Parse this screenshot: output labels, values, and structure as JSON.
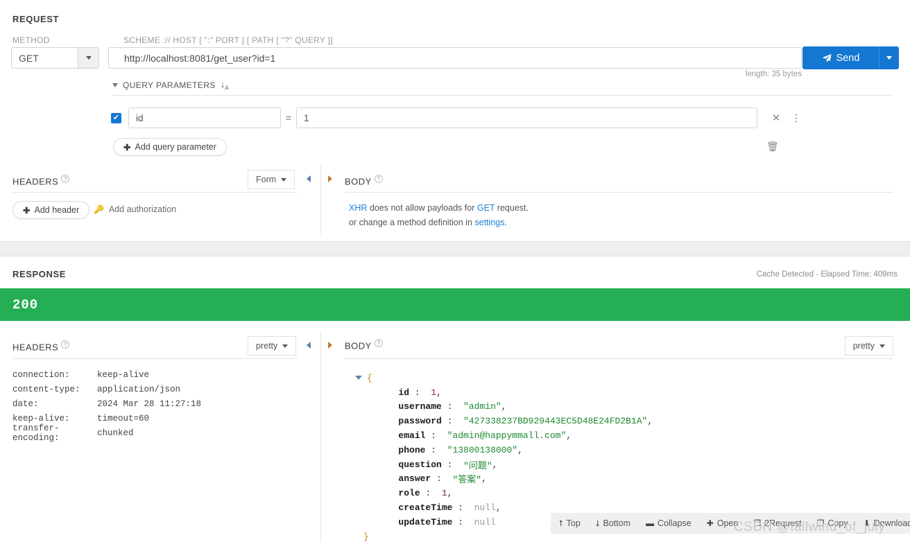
{
  "request": {
    "title": "REQUEST",
    "method_label": "METHOD",
    "method_value": "GET",
    "url_label": "SCHEME :// HOST [ \":\" PORT ] [ PATH [ \"?\" QUERY ]]",
    "url_value": "http://localhost:8081/get_user?id=1",
    "length_note": "length: 35 bytes",
    "send_label": "Send",
    "query_parameters": {
      "title": "QUERY PARAMETERS",
      "sort_icon": "sort-icon",
      "rows": [
        {
          "enabled": true,
          "key": "id",
          "equals": "=",
          "value": "1"
        }
      ],
      "add_label": "Add query parameter",
      "remove_icon": "close-icon",
      "menu_icon": "more-vertical-icon",
      "trash_icon": "trash-icon"
    },
    "headers": {
      "title": "HEADERS",
      "format_value": "Form",
      "add_header_label": "Add header",
      "add_authorization_label": "Add authorization"
    },
    "body": {
      "title": "BODY",
      "message_line1_pre": "",
      "message_line1_link1": "XHR",
      "message_line1_mid": " does not allow payloads for ",
      "message_line1_link2": "GET",
      "message_line1_post": " request.",
      "message_line2_pre": "or change a method definition in ",
      "message_line2_link": "settings",
      "message_line2_post": "."
    }
  },
  "response": {
    "title": "RESPONSE",
    "elapsed": "Cache Detected - Elapsed Time: 409ms",
    "status_code": "200",
    "status_color": "#24af55",
    "headers": {
      "title": "HEADERS",
      "format_value": "pretty",
      "rows": [
        {
          "name": "connection:",
          "value": "keep-alive"
        },
        {
          "name": "content-type:",
          "value": "application/json"
        },
        {
          "name": "date:",
          "value": "2024 Mar 28 11:27:18"
        },
        {
          "name": "keep-alive:",
          "value": "timeout=60"
        },
        {
          "name": "transfer-encoding:",
          "value": "chunked"
        }
      ]
    },
    "body": {
      "title": "BODY",
      "format_value": "pretty",
      "json_lines": [
        {
          "indent": 0,
          "toggle": true,
          "brace": "{"
        },
        {
          "indent": 1,
          "key": "id",
          "sep": " : ",
          "value": "1",
          "kind": "num",
          "comma": ","
        },
        {
          "indent": 1,
          "key": "username",
          "sep": " : ",
          "value": "\"admin\"",
          "kind": "str",
          "comma": ","
        },
        {
          "indent": 1,
          "key": "password",
          "sep": " : ",
          "value": "\"427338237BD929443EC5D48E24FD2B1A\"",
          "kind": "str",
          "comma": ","
        },
        {
          "indent": 1,
          "key": "email",
          "sep": " : ",
          "value": "\"admin@happymmall.com\"",
          "kind": "str",
          "comma": ","
        },
        {
          "indent": 1,
          "key": "phone",
          "sep": " : ",
          "value": "\"13800138000\"",
          "kind": "str",
          "comma": ","
        },
        {
          "indent": 1,
          "key": "question",
          "sep": " : ",
          "value": "\"问题\"",
          "kind": "str",
          "comma": ","
        },
        {
          "indent": 1,
          "key": "answer",
          "sep": " : ",
          "value": "\"答案\"",
          "kind": "str",
          "comma": ","
        },
        {
          "indent": 1,
          "key": "role",
          "sep": " : ",
          "value": "1",
          "kind": "num",
          "comma": ","
        },
        {
          "indent": 1,
          "key": "createTime",
          "sep": " : ",
          "value": "null",
          "kind": "null",
          "comma": ","
        },
        {
          "indent": 1,
          "key": "updateTime",
          "sep": " : ",
          "value": "null",
          "kind": "null",
          "comma": ""
        },
        {
          "indent": 0,
          "brace": "}"
        }
      ]
    },
    "toolbar": [
      {
        "icon": "arrow-up-circle-icon",
        "glyph": "⭡",
        "label": "Top"
      },
      {
        "icon": "arrow-down-circle-icon",
        "glyph": "⭣",
        "label": "Bottom"
      },
      {
        "icon": "collapse-icon",
        "glyph": "▬",
        "label": "Collapse"
      },
      {
        "icon": "expand-icon",
        "glyph": "✚",
        "label": "Open"
      },
      {
        "icon": "request-icon",
        "glyph": "❐",
        "label": "2Request"
      },
      {
        "icon": "copy-icon",
        "glyph": "❐",
        "label": "Copy"
      },
      {
        "icon": "download-icon",
        "glyph": "⬇",
        "label": "Download"
      }
    ]
  },
  "watermark": "CSDN @fallwind_of_july"
}
